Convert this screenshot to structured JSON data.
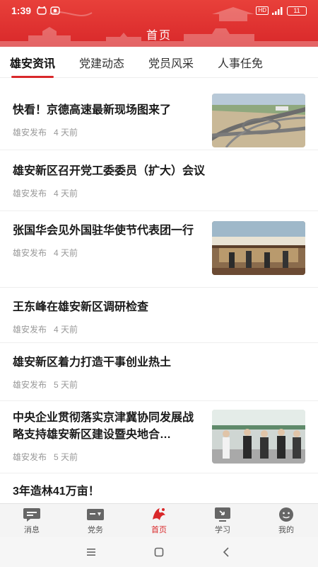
{
  "status_bar": {
    "time": "1:39",
    "battery": "11",
    "hd_badge": "HD"
  },
  "header": {
    "title": "首页"
  },
  "tabs": [
    {
      "label": "雄安资讯",
      "active": true
    },
    {
      "label": "党建动态",
      "active": false
    },
    {
      "label": "党员风采",
      "active": false
    },
    {
      "label": "人事任免",
      "active": false
    }
  ],
  "feed": [
    {
      "headline": "快看！京德高速最新现场图来了",
      "source": "雄安发布",
      "age": "4 天前",
      "thumbnail": "highway-interchange-aerial"
    },
    {
      "headline": "雄安新区召开党工委委员（扩大）会议",
      "source": "雄安发布",
      "age": "4 天前"
    },
    {
      "headline": "张国华会见外国驻华使节代表团一行",
      "source": "雄安发布",
      "age": "4 天前",
      "thumbnail": "meeting-photo"
    },
    {
      "headline": "王东峰在雄安新区调研检查",
      "source": "雄安发布",
      "age": "4 天前"
    },
    {
      "headline": "雄安新区着力打造干事创业热土",
      "source": "雄安发布",
      "age": "5 天前"
    },
    {
      "headline": "中央企业贯彻落实京津冀协同发展战略支持雄安新区建设暨央地合…",
      "source": "雄安发布",
      "age": "5 天前",
      "thumbnail": "officials-visit-photo"
    },
    {
      "headline": "3年造林41万亩！"
    }
  ],
  "bottom_nav": [
    {
      "label": "消息",
      "icon": "message-icon",
      "active": false
    },
    {
      "label": "党务",
      "icon": "party-affairs-icon",
      "active": false
    },
    {
      "label": "首页",
      "icon": "home-logo-icon",
      "active": true
    },
    {
      "label": "学习",
      "icon": "study-icon",
      "active": false
    },
    {
      "label": "我的",
      "icon": "profile-icon",
      "active": false
    }
  ],
  "colors": {
    "brand_red": "#d9282a",
    "meta_gray": "#999999"
  }
}
